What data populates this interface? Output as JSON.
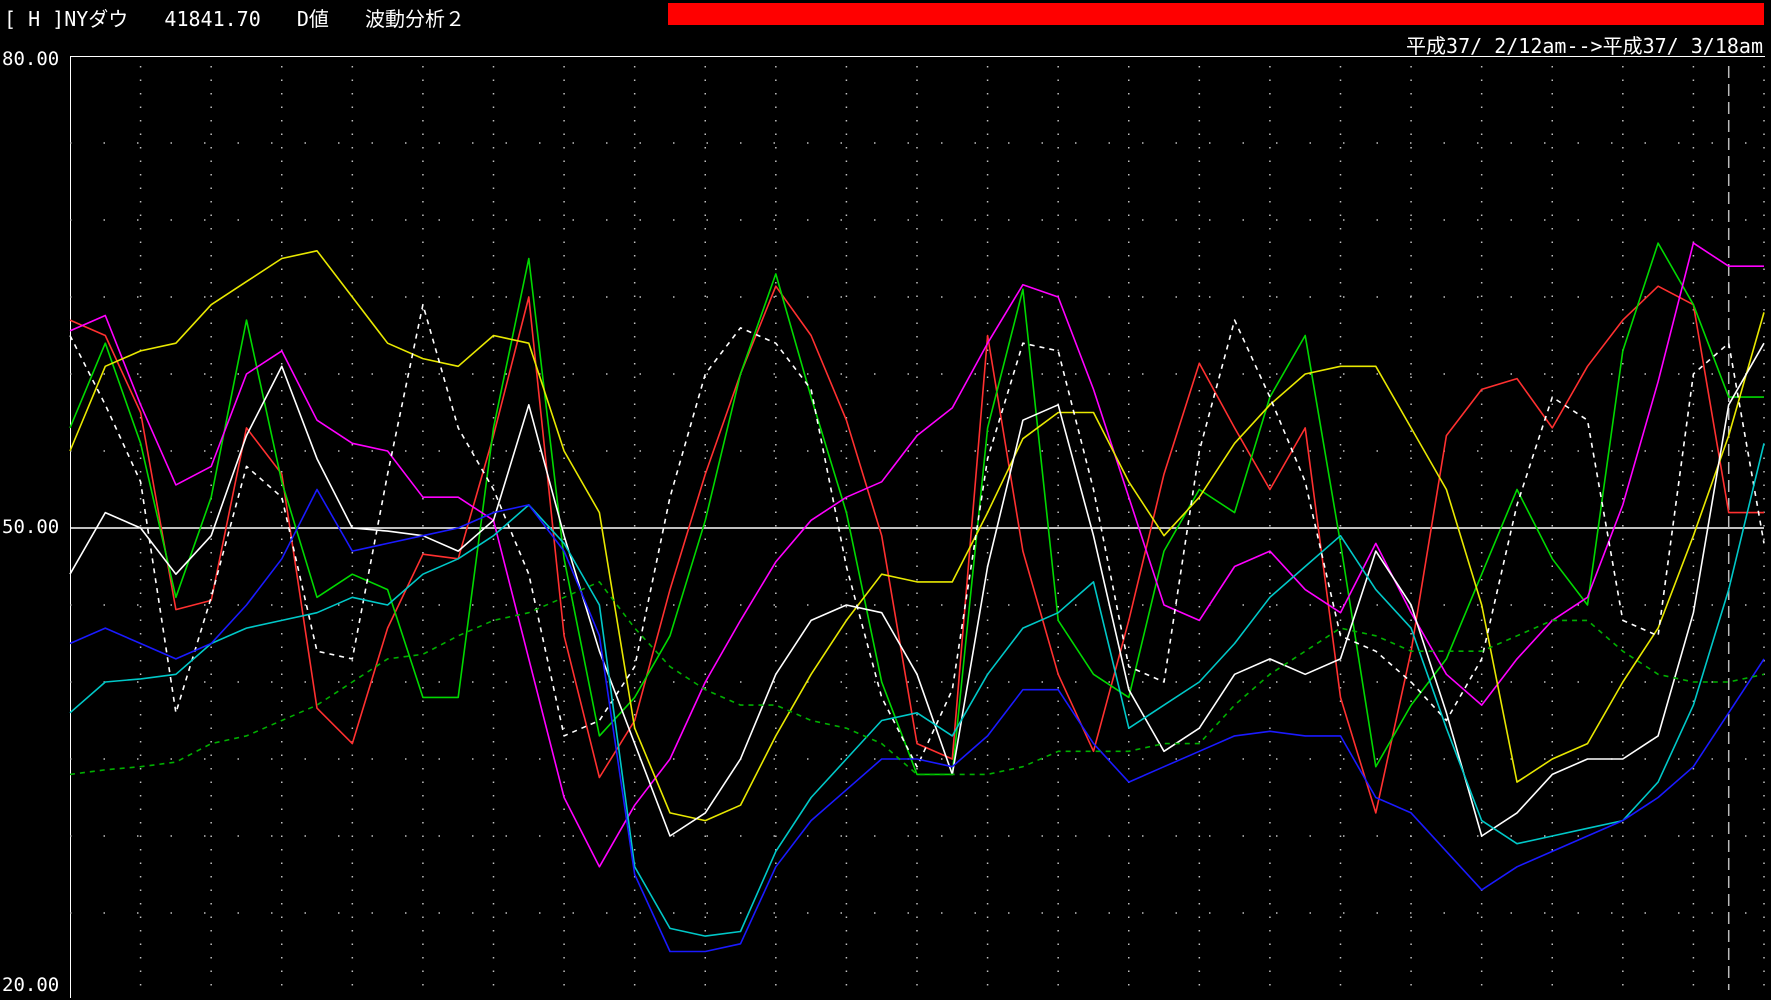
{
  "header": {
    "title": "[ H ]NYダウ   41841.70   D値   波動分析２",
    "date_range": "平成37/ 2/12am-->平成37/ 3/18am"
  },
  "colors": {
    "background": "#000000",
    "status_bar": "#ff0000"
  },
  "chart_data": {
    "type": "line",
    "title": "",
    "xlabel": "",
    "ylabel": "",
    "ylim": [
      20,
      80
    ],
    "yticks": [
      "80.00",
      "50.00",
      "20.00"
    ],
    "reference_line": 50,
    "grid": "dotted",
    "x": [
      0,
      1,
      2,
      3,
      4,
      5,
      6,
      7,
      8,
      9,
      10,
      11,
      12,
      13,
      14,
      15,
      16,
      17,
      18,
      19,
      20,
      21,
      22,
      23,
      24,
      25,
      26,
      27,
      28,
      29,
      30,
      31,
      32,
      33,
      34,
      35,
      36,
      37,
      38,
      39,
      40,
      41,
      42,
      43,
      44,
      45,
      46,
      47,
      48
    ],
    "series": [
      {
        "color": "#ff3030",
        "dash": false,
        "values": [
          63.5,
          62.5,
          57.5,
          44.7,
          45.3,
          56.5,
          53.5,
          38.3,
          36.0,
          43.5,
          48.3,
          48.0,
          56.0,
          65.0,
          43.0,
          33.8,
          37.5,
          46.0,
          53.5,
          60.0,
          65.7,
          62.5,
          57.0,
          49.5,
          36.0,
          35.0,
          62.5,
          48.5,
          40.5,
          35.5,
          44.0,
          53.5,
          60.7,
          56.5,
          52.5,
          56.5,
          39.0,
          31.5,
          42.0,
          56.0,
          59.0,
          59.7,
          56.5,
          60.5,
          63.5,
          65.7,
          64.5,
          51.0,
          51.0
        ]
      },
      {
        "color": "#00d800",
        "dash": false,
        "values": [
          56.5,
          62.0,
          55.5,
          45.5,
          52.0,
          63.5,
          53.0,
          45.5,
          47.0,
          46.0,
          39.0,
          39.0,
          56.5,
          67.5,
          48.0,
          36.5,
          39.0,
          43.0,
          50.5,
          60.0,
          66.5,
          58.5,
          51.0,
          40.0,
          34.0,
          34.0,
          56.5,
          65.5,
          44.0,
          40.5,
          39.0,
          48.5,
          52.5,
          51.0,
          58.5,
          62.5,
          49.0,
          34.5,
          38.5,
          41.5,
          47.0,
          52.5,
          48.0,
          45.0,
          61.5,
          68.5,
          64.5,
          58.5,
          58.5
        ]
      },
      {
        "color": "#ff00ff",
        "dash": false,
        "values": [
          62.8,
          63.8,
          58.0,
          52.8,
          54.0,
          60.0,
          61.5,
          57.0,
          55.5,
          55.0,
          52.0,
          52.0,
          50.5,
          41.5,
          32.5,
          28.0,
          32.0,
          35.0,
          40.0,
          44.0,
          47.8,
          50.5,
          52.0,
          53.0,
          56.0,
          57.8,
          62.0,
          65.8,
          65.0,
          59.0,
          52.0,
          45.0,
          44.0,
          47.5,
          48.5,
          46.0,
          44.5,
          49.0,
          44.5,
          40.5,
          38.5,
          41.5,
          44.0,
          45.5,
          51.5,
          59.5,
          68.5,
          67.0,
          67.0
        ]
      },
      {
        "color": "#e8e800",
        "dash": false,
        "values": [
          55.0,
          60.5,
          61.5,
          62.0,
          64.5,
          66.0,
          67.5,
          68.0,
          65.0,
          62.0,
          61.0,
          60.5,
          62.5,
          62.0,
          55.0,
          51.0,
          37.0,
          31.5,
          31.0,
          32.0,
          36.5,
          40.5,
          44.0,
          47.0,
          46.5,
          46.5,
          51.0,
          55.8,
          57.5,
          57.5,
          53.0,
          49.5,
          52.0,
          55.5,
          58.0,
          60.0,
          60.5,
          60.5,
          56.5,
          52.5,
          45.0,
          33.5,
          35.0,
          36.0,
          40.0,
          43.5,
          49.5,
          56.0,
          64.0
        ]
      },
      {
        "color": "#ffffff",
        "dash": false,
        "values": [
          47.0,
          51.0,
          50.0,
          47.0,
          49.5,
          56.0,
          60.5,
          54.5,
          50.0,
          49.8,
          49.5,
          48.5,
          50.5,
          58.0,
          49.5,
          42.0,
          36.0,
          30.0,
          31.5,
          35.0,
          40.5,
          44.0,
          45.0,
          44.5,
          40.5,
          34.0,
          47.5,
          57.0,
          58.0,
          49.5,
          39.5,
          35.5,
          37.0,
          40.5,
          41.5,
          40.5,
          41.5,
          48.5,
          45.0,
          38.0,
          30.0,
          31.5,
          34.0,
          35.0,
          35.0,
          36.5,
          44.5,
          58.0,
          62.0
        ]
      },
      {
        "color": "#ffffff",
        "dash": true,
        "values": [
          62.5,
          58.0,
          53.0,
          38.0,
          45.5,
          54.0,
          52.0,
          42.0,
          41.5,
          53.5,
          64.5,
          56.5,
          52.5,
          47.0,
          36.5,
          37.5,
          41.0,
          52.0,
          60.0,
          63.0,
          62.0,
          59.0,
          47.5,
          39.0,
          34.5,
          39.5,
          54.5,
          62.0,
          61.5,
          52.5,
          41.0,
          40.0,
          55.0,
          63.5,
          58.5,
          53.0,
          43.0,
          42.0,
          40.0,
          37.5,
          41.5,
          51.5,
          58.5,
          57.0,
          44.0,
          43.0,
          60.0,
          62.0,
          49.0
        ]
      },
      {
        "color": "#00c8c8",
        "dash": false,
        "values": [
          38.0,
          40.0,
          40.2,
          40.5,
          42.5,
          43.5,
          44.0,
          44.5,
          45.5,
          45.0,
          47.0,
          48.0,
          49.5,
          51.5,
          49.0,
          45.0,
          28.0,
          24.0,
          23.5,
          23.8,
          29.0,
          32.5,
          35.0,
          37.5,
          38.0,
          36.5,
          40.5,
          43.5,
          44.5,
          46.5,
          37.0,
          38.5,
          40.0,
          42.5,
          45.5,
          47.5,
          49.5,
          46.0,
          43.5,
          37.0,
          31.0,
          29.5,
          30.0,
          30.5,
          31.0,
          33.5,
          38.5,
          46.0,
          55.5
        ]
      },
      {
        "color": "#1a1aff",
        "dash": false,
        "values": [
          42.5,
          43.5,
          42.5,
          41.5,
          42.5,
          45.0,
          48.0,
          52.5,
          48.5,
          49.0,
          49.5,
          50.0,
          51.0,
          51.5,
          48.5,
          43.0,
          27.5,
          22.5,
          22.5,
          23.0,
          28.0,
          31.0,
          33.0,
          35.0,
          35.0,
          34.5,
          36.5,
          39.5,
          39.5,
          36.0,
          33.5,
          34.5,
          35.5,
          36.5,
          36.8,
          36.5,
          36.5,
          32.5,
          31.5,
          29.0,
          26.5,
          28.0,
          29.0,
          30.0,
          31.0,
          32.5,
          34.5,
          38.0,
          41.5
        ]
      },
      {
        "color": "#00b000",
        "dash": true,
        "values": [
          34.0,
          34.3,
          34.5,
          34.8,
          36.0,
          36.5,
          37.5,
          38.5,
          40.0,
          41.5,
          41.8,
          43.0,
          44.0,
          44.5,
          45.5,
          46.5,
          43.5,
          41.0,
          39.5,
          38.5,
          38.5,
          37.5,
          37.0,
          36.0,
          34.0,
          34.0,
          34.0,
          34.5,
          35.5,
          35.5,
          35.5,
          36.0,
          36.0,
          38.5,
          40.5,
          42.0,
          43.5,
          43.0,
          42.0,
          42.0,
          42.0,
          43.0,
          44.0,
          44.0,
          42.0,
          40.5,
          40.0,
          40.0,
          40.5
        ]
      }
    ]
  }
}
